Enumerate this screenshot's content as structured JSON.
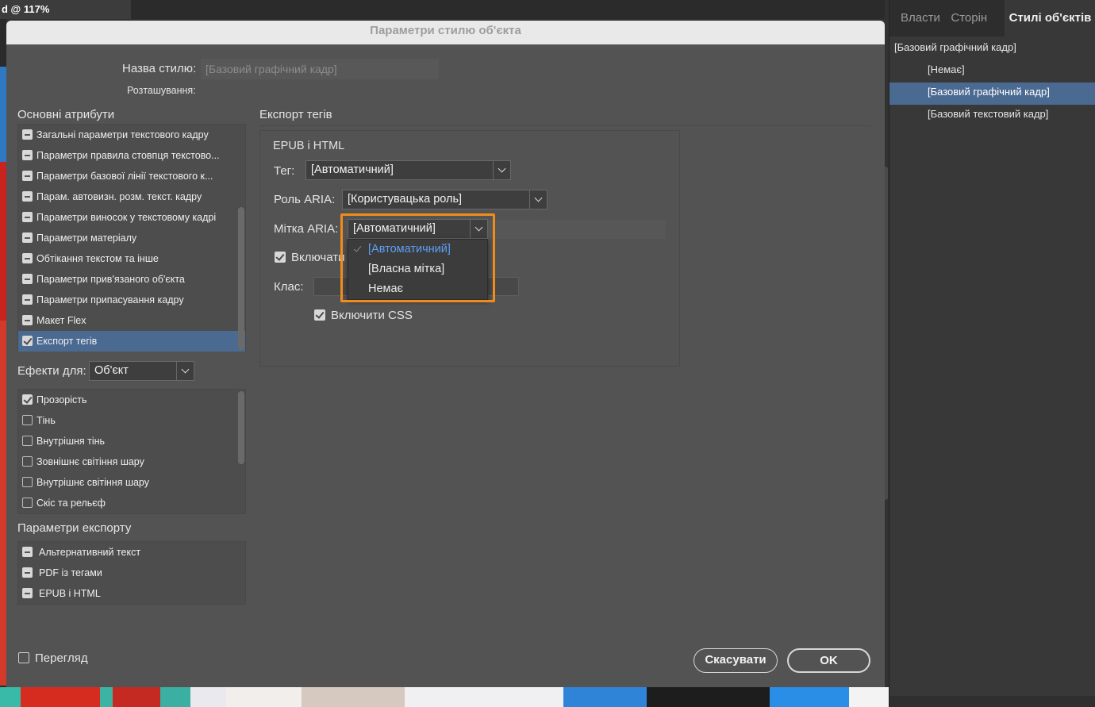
{
  "app": {
    "doc_tab": "d @ 117%"
  },
  "right_panel": {
    "tabs": [
      "Власти",
      "Сторін",
      "Стилі об'єктів"
    ],
    "items": [
      {
        "label": "[Базовий графічний кадр]"
      },
      {
        "label": "[Немає]"
      },
      {
        "label": "[Базовий графічний кадр]"
      },
      {
        "label": "[Базовий текстовий кадр]"
      }
    ]
  },
  "dialog": {
    "title": "Параметри стилю об'єкта",
    "style_name_label": "Назва стилю:",
    "style_name_value": "[Базовий графічний кадр]",
    "location_label": "Розташування:",
    "basic_attrs_title": "Основні атрибути",
    "basic_attrs": [
      {
        "label": "Загальні параметри текстового кадру",
        "state": "mixed"
      },
      {
        "label": "Параметри правила стовпця текстово...",
        "state": "mixed"
      },
      {
        "label": "Параметри базової лінії текстового к...",
        "state": "mixed"
      },
      {
        "label": "Парам. автовизн. розм. текст. кадру",
        "state": "mixed"
      },
      {
        "label": "Параметри виносок у текстовому кадрі",
        "state": "mixed"
      },
      {
        "label": "Параметри матеріалу",
        "state": "mixed"
      },
      {
        "label": "Обтікання текстом та інше",
        "state": "mixed"
      },
      {
        "label": "Параметри прив'язаного об'єкта",
        "state": "mixed"
      },
      {
        "label": "Параметри припасування кадру",
        "state": "mixed"
      },
      {
        "label": "Макет Flex",
        "state": "mixed"
      },
      {
        "label": "Експорт тегів",
        "state": "checked"
      }
    ],
    "effects_label": "Ефекти для:",
    "effects_value": "Об'єкт",
    "effects": [
      {
        "label": "Прозорість",
        "state": "checked"
      },
      {
        "label": "Тінь",
        "state": "unchecked"
      },
      {
        "label": "Внутрішня тінь",
        "state": "unchecked"
      },
      {
        "label": "Зовнішнє світіння шару",
        "state": "unchecked"
      },
      {
        "label": "Внутрішнє світіння шару",
        "state": "unchecked"
      },
      {
        "label": "Скіс та рельєф",
        "state": "unchecked"
      }
    ],
    "export_params_title": "Параметри експорту",
    "export_params": [
      {
        "label": "Альтернативний текст",
        "state": "mixed"
      },
      {
        "label": "PDF із тегами",
        "state": "mixed"
      },
      {
        "label": "EPUB і HTML",
        "state": "mixed"
      }
    ],
    "preview_label": "Перегляд",
    "cancel_label": "Скасувати",
    "ok_label": "OK",
    "export_tags": {
      "title": "Експорт тегів",
      "group_title": "EPUB і HTML",
      "tag_label": "Тег:",
      "tag_value": "[Автоматичний]",
      "aria_role_label": "Роль ARIA:",
      "aria_role_value": "[Користувацька роль]",
      "aria_label_label": "Мітка ARIA:",
      "aria_label_value": "[Автоматичний]",
      "include_label": "Включати",
      "class_label": "Клас:",
      "include_css_label": "Включити CSS",
      "aria_label_options": [
        "[Автоматичний]",
        "[Власна мітка]",
        "Немає"
      ]
    }
  },
  "colors": {
    "accent_selection": "#4b6a92",
    "highlight_box": "#f08c1a",
    "dropdown_selected_text": "#5d9ff6"
  }
}
